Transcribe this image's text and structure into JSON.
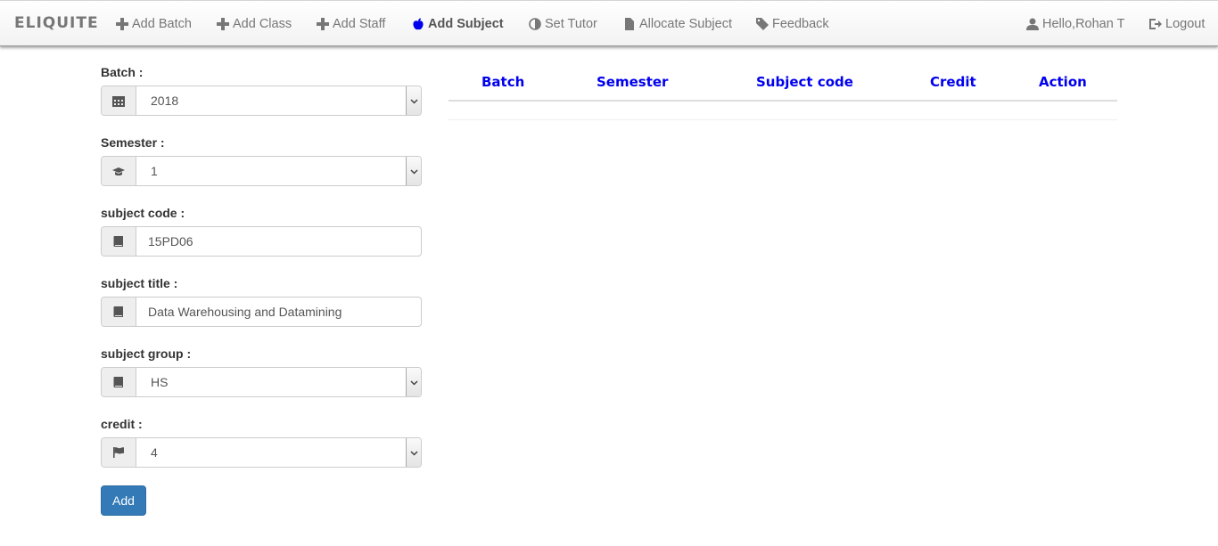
{
  "navbar": {
    "brand": "ELIQUITE",
    "items": [
      {
        "label": "Add Batch",
        "icon": "plus-icon"
      },
      {
        "label": "Add Class",
        "icon": "plus-icon"
      },
      {
        "label": "Add Staff",
        "icon": "plus-icon"
      },
      {
        "label": "Add Subject",
        "icon": "apple-icon",
        "active": true
      },
      {
        "label": "Set Tutor",
        "icon": "adjust-icon"
      },
      {
        "label": "Allocate Subject",
        "icon": "file-icon"
      },
      {
        "label": "Feedback",
        "icon": "tag-icon"
      }
    ],
    "user": {
      "label": "Hello,Rohan T",
      "icon": "user-icon"
    },
    "logout": {
      "label": "Logout",
      "icon": "logout-icon"
    }
  },
  "form": {
    "batch": {
      "label": "Batch :",
      "value": "2018",
      "icon": "calendar-icon"
    },
    "semester": {
      "label": "Semester :",
      "value": "1",
      "icon": "graduation-cap-icon"
    },
    "subject_code": {
      "label": "subject code :",
      "value": "15PD06",
      "icon": "book-icon"
    },
    "subject_title": {
      "label": "subject title :",
      "value": "Data Warehousing and Datamining",
      "icon": "book-icon"
    },
    "subject_group": {
      "label": "subject group :",
      "value": "HS",
      "icon": "book-icon"
    },
    "credit": {
      "label": "credit :",
      "value": "4",
      "icon": "flag-icon"
    },
    "add_button": "Add"
  },
  "table": {
    "columns": [
      "Batch",
      "Semester",
      "Subject code",
      "Credit",
      "Action"
    ],
    "rows": []
  },
  "colors": {
    "accent": "#337ab7",
    "header_text": "#0000ee"
  }
}
